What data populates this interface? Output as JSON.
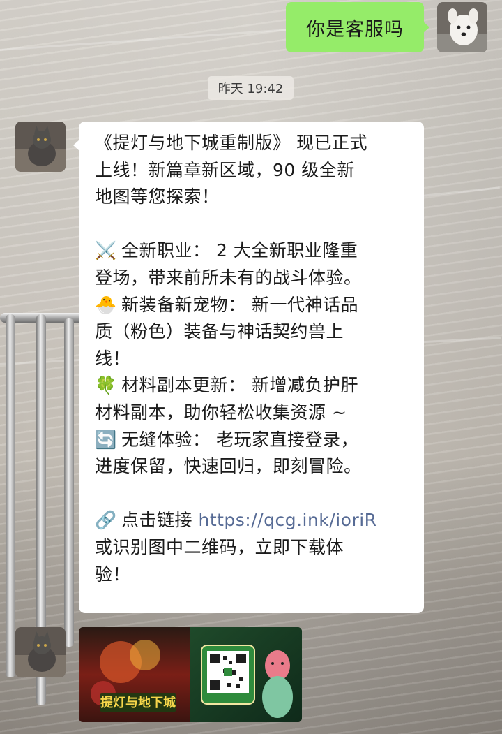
{
  "outgoing": {
    "text": "你是客服吗"
  },
  "timestamp": "昨天 19:42",
  "incoming": {
    "lines": [
      "《提灯与地下城重制版》 现已正式",
      "上线！新篇章新区域，90 级全新",
      "地图等您探索！",
      "",
      "全新职业： 2 大全新职业隆重",
      "登场，带来前所未有的战斗体验。",
      "新装备新宠物： 新一代神话品",
      "质（粉色）装备与神话契约兽上",
      "线！",
      "材料副本更新： 新增减负护肝",
      "材料副本，助你轻松收集资源 ~",
      "无缝体验： 老玩家直接登录，",
      "进度保留，快速回归，即刻冒险。",
      "",
      "点击链接",
      "https://qcg.ink/ioriR",
      "或识别图中二维码，立即下载体",
      "验！"
    ],
    "icons": {
      "swords": "⚔️",
      "chick": "🐣",
      "clover": "🍀",
      "refresh": "🔄",
      "link": "🔗"
    }
  },
  "image_card": {
    "title_art": "提灯与地下城"
  },
  "colors": {
    "outgoing_bubble": "#95ec69",
    "link": "#576b95"
  }
}
